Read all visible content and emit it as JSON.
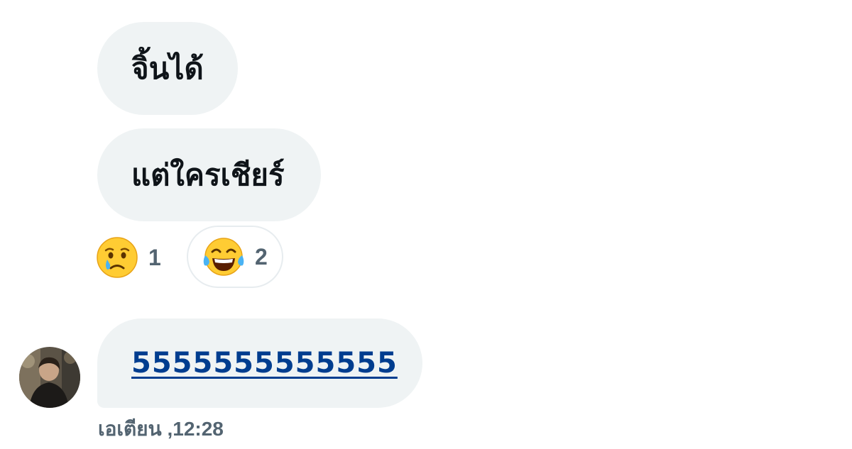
{
  "messages": [
    {
      "text": "จิ้นได้"
    },
    {
      "text": "แต่ใครเชียร์"
    },
    {
      "text": "5555555555555"
    }
  ],
  "reactions": [
    {
      "emoji": "crying-face-emoji",
      "count": "1"
    },
    {
      "emoji": "tears-of-joy-emoji",
      "count": "2"
    }
  ],
  "sender": {
    "name": "เอเตียน",
    "separator": ",",
    "time": "12:28"
  },
  "colors": {
    "bubble": "#eff3f4",
    "link": "#003d8f",
    "muted": "#536471"
  }
}
